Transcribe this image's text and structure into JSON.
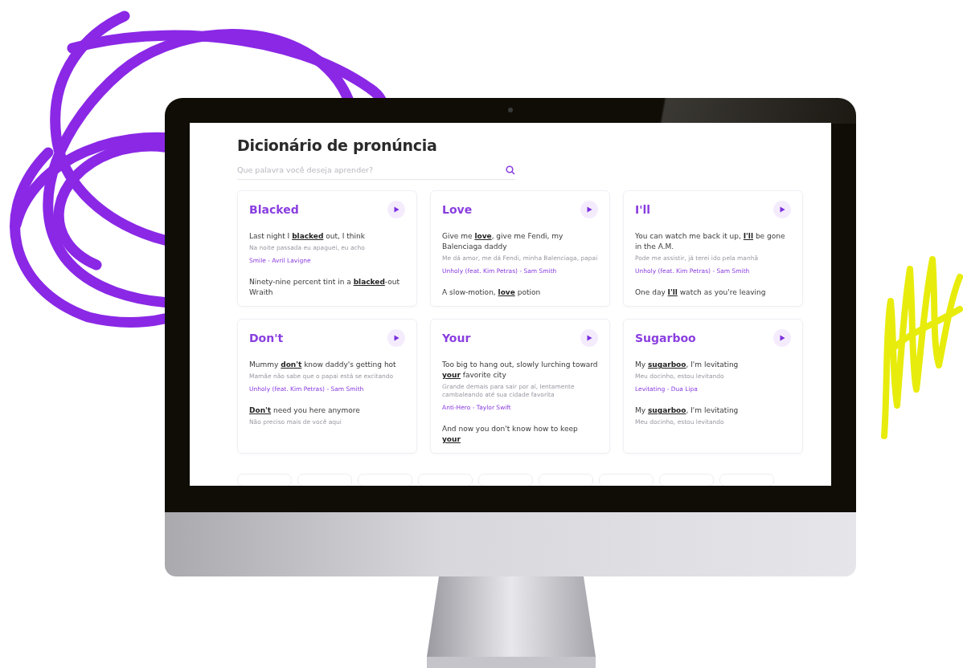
{
  "title": "Dicionário de pronúncia",
  "search": {
    "placeholder": "Que palavra você deseja aprender?"
  },
  "cards": [
    {
      "word": "Blacked",
      "examples": [
        {
          "lyric": "Last night I **blacked** out, I think",
          "translation": "Na noite passada eu apaguei, eu acho",
          "source": "Smile - Avril Lavigne"
        },
        {
          "lyric": "Ninety-nine percent tint in a **blacked**-out Wraith"
        }
      ]
    },
    {
      "word": "Love",
      "examples": [
        {
          "lyric": "Give me **love**, give me Fendi, my Balenciaga daddy",
          "translation": "Me dá amor, me dá Fendi, minha Balenciaga, papai",
          "source": "Unholy (feat. Kim Petras) - Sam Smith"
        },
        {
          "lyric": "A slow-motion, **love** potion"
        }
      ]
    },
    {
      "word": "I'll",
      "examples": [
        {
          "lyric": "You can watch me back it up, **I'll** be gone in the A.M.",
          "translation": "Pode me assistir, já terei ido pela manhã",
          "source": "Unholy (feat. Kim Petras) - Sam Smith"
        },
        {
          "lyric": "One day **I'll** watch as you're leaving"
        }
      ]
    },
    {
      "word": "Don't",
      "examples": [
        {
          "lyric": "Mummy **don't** know daddy's getting hot",
          "translation": "Mamãe não sabe que o papai está se excitando",
          "source": "Unholy (feat. Kim Petras) - Sam Smith"
        },
        {
          "lyric": "**Don't** need you here anymore",
          "translation": "Não preciso mais de você aqui"
        }
      ]
    },
    {
      "word": "Your",
      "examples": [
        {
          "lyric": "Too big to hang out, slowly lurching toward **your** favorite city",
          "translation": "Grande demais para sair por aí, lentamente cambaleando até sua cidade favorita",
          "source": "Anti-Hero - Taylor Swift"
        },
        {
          "lyric": "And now you don't know how to keep **your**"
        }
      ]
    },
    {
      "word": "Sugarboo",
      "examples": [
        {
          "lyric": "My **sugarboo**, I'm levitating",
          "translation": "Meu docinho, estou levitando",
          "source": "Levitating - Dua Lipa"
        },
        {
          "lyric": "My **sugarboo**, I'm levitating",
          "translation": "Meu docinho, estou levitando"
        }
      ]
    }
  ]
}
